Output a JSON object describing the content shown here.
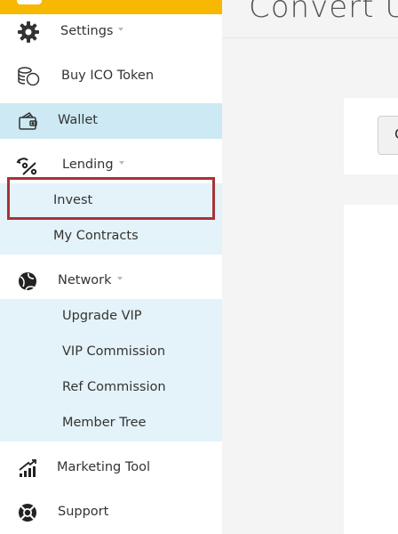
{
  "sidebar": {
    "settings": "Settings",
    "buy_ico": "Buy ICO Token",
    "wallet": "Wallet",
    "lending": "Lending",
    "lending_items": [
      "Invest",
      "My Contracts"
    ],
    "network": "Network",
    "network_items": [
      "Upgrade VIP",
      "VIP Commission",
      "Ref Commission",
      "Member Tree"
    ],
    "marketing": "Marketing Tool",
    "support": "Support"
  },
  "main": {
    "title": "Convert U",
    "button_text": "C"
  },
  "colors": {
    "accent": "#f6b800",
    "active_item_bg": "#cde9f3",
    "submenu_bg": "#e4f3f9",
    "highlight_border": "#a83237"
  },
  "icons": {
    "settings": "gear-icon",
    "buy_ico": "coins-icon",
    "wallet": "wallet-icon",
    "lending": "percent-icon",
    "network": "globe-icon",
    "marketing": "growth-chart-icon",
    "support": "lifebuoy-icon"
  }
}
